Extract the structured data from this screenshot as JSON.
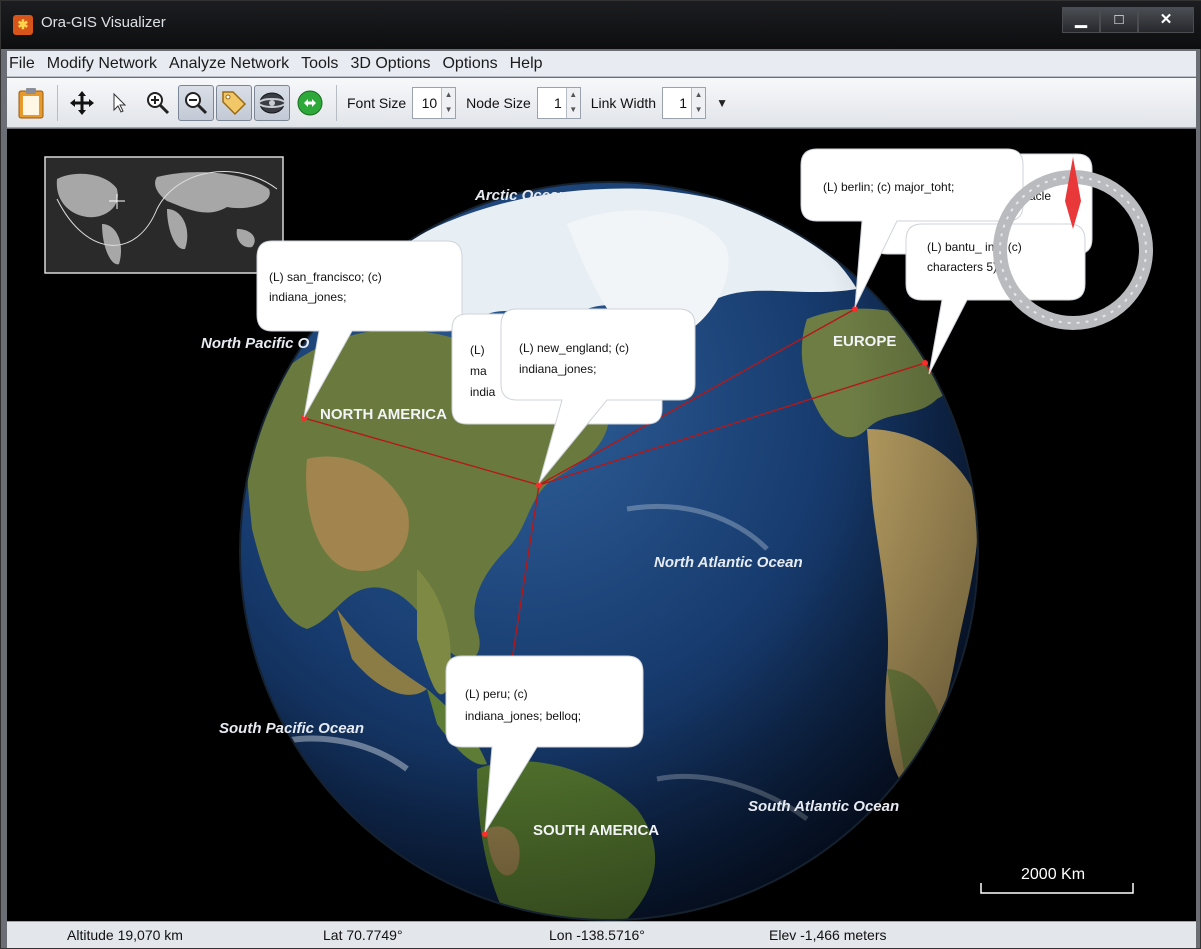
{
  "window": {
    "title": "Ora-GIS Visualizer",
    "controls": [
      "▁",
      "□",
      "✕"
    ]
  },
  "menu": [
    "File",
    "Modify Network",
    "Analyze Network",
    "Tools",
    "3D Options",
    "Options",
    "Help"
  ],
  "toolbar": {
    "icons": [
      "clipboard-icon",
      "pan-icon",
      "select-arrow-icon",
      "zoom-in-icon",
      "zoom-out-icon",
      "tag-icon",
      "globe-icon",
      "refresh-icon"
    ],
    "font_size_label": "Font Size",
    "font_size_value": "10",
    "node_size_label": "Node Size",
    "node_size_value": "1",
    "link_width_label": "Link Width",
    "link_width_value": "1"
  },
  "map": {
    "ocean_labels": {
      "arctic": "Arctic Ocean",
      "north_pacific": "North Pacific O",
      "north_atlantic": "North Atlantic Ocean",
      "south_pacific": "South Pacific Ocean",
      "south_atlantic": "South Atlantic Ocean"
    },
    "continent_labels": {
      "north_america": "NORTH AMERICA",
      "south_america": "SOUTH AMERICA",
      "europe": "EUROPE"
    },
    "callouts": {
      "san_francisco": [
        "(L) san_francisco;  (c)",
        "indiana_jones;"
      ],
      "hidden_left": [
        "(L)",
        "ma",
        "india"
      ],
      "new_england": [
        "(L) new_england;  (c)",
        "indiana_jones;"
      ],
      "berlin": [
        "(L) berlin;  (c) major_toht;",
        ""
      ],
      "bantu": [
        "(L) bantu_    ind;  (c)",
        "characters   5);"
      ],
      "partial": [
        "acle"
      ],
      "peru": [
        "(L) peru;  (c)",
        "indiana_jones; belloq;"
      ]
    },
    "scale_label": "2000 Km",
    "colors": {
      "link": "#b41818",
      "node": "#ff2a2a",
      "compass_needle": "#e8383a"
    }
  },
  "status": {
    "altitude": "Altitude  19,070 km",
    "lat": "Lat 70.7749°",
    "lon": "Lon -138.5716°",
    "elev": "Elev  -1,466 meters"
  }
}
